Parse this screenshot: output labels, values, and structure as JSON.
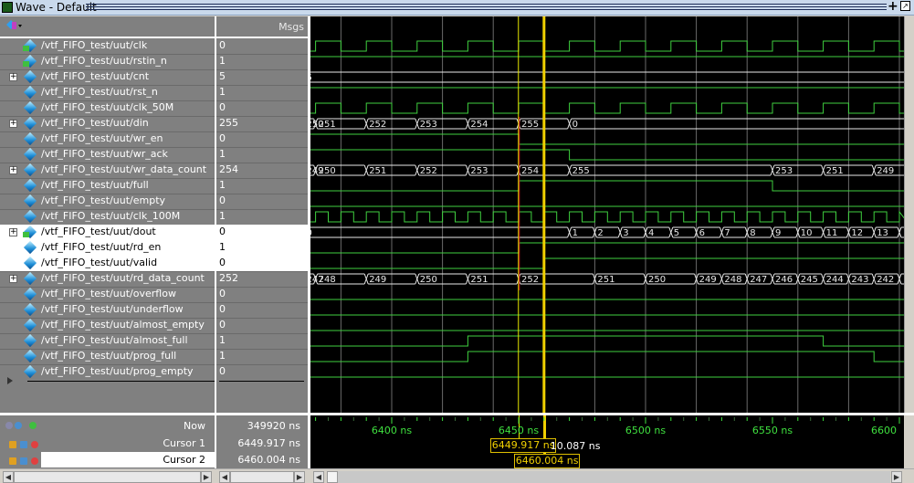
{
  "window": {
    "title": "Wave - Default"
  },
  "header": {
    "msgs_label": "Msgs"
  },
  "colors": {
    "wave_bg": "#000000",
    "signal": "#3fd03f",
    "bus": "#e8e8e8",
    "cursor1": "#e8e800",
    "cursor2": "#f0d000",
    "timeline_text": "#3fe03f"
  },
  "time_axis": {
    "unit": "ns",
    "ticks": [
      6400,
      6450,
      6500,
      6550,
      6600
    ],
    "tick_labels": [
      "6400 ns",
      "6450 ns",
      "6500 ns",
      "6550 ns",
      "6600"
    ],
    "range": [
      6368,
      6602
    ]
  },
  "signals": [
    {
      "name": "/vtf_FIFO_test/uut/clk",
      "value": "0",
      "kind": "clock",
      "period": 20,
      "first_rise": 6370,
      "high": 10,
      "icon": "input"
    },
    {
      "name": "/vtf_FIFO_test/uut/rstin_n",
      "value": "1",
      "kind": "bit",
      "changes": [
        [
          6360,
          1
        ]
      ],
      "icon": "input"
    },
    {
      "name": "/vtf_FIFO_test/uut/cnt",
      "value": "5",
      "kind": "bus",
      "expandable": true,
      "changes": [
        [
          6360,
          "5"
        ]
      ]
    },
    {
      "name": "/vtf_FIFO_test/uut/rst_n",
      "value": "1",
      "kind": "bit",
      "changes": [
        [
          6360,
          1
        ]
      ]
    },
    {
      "name": "/vtf_FIFO_test/uut/clk_50M",
      "value": "0",
      "kind": "clock",
      "period": 20,
      "first_rise": 6370,
      "high": 10
    },
    {
      "name": "/vtf_FIFO_test/uut/din",
      "value": "255",
      "kind": "bus",
      "expandable": true,
      "changes": [
        [
          6360,
          "250"
        ],
        [
          6370,
          "251"
        ],
        [
          6390,
          "252"
        ],
        [
          6410,
          "253"
        ],
        [
          6430,
          "254"
        ],
        [
          6450,
          "255"
        ],
        [
          6470,
          "0"
        ]
      ]
    },
    {
      "name": "/vtf_FIFO_test/uut/wr_en",
      "value": "0",
      "kind": "bit",
      "changes": [
        [
          6360,
          1
        ],
        [
          6450,
          0
        ]
      ]
    },
    {
      "name": "/vtf_FIFO_test/uut/wr_ack",
      "value": "1",
      "kind": "bit",
      "changes": [
        [
          6360,
          1
        ],
        [
          6450,
          1
        ],
        [
          6470,
          0
        ]
      ]
    },
    {
      "name": "/vtf_FIFO_test/uut/wr_data_count",
      "value": "254",
      "kind": "bus",
      "expandable": true,
      "changes": [
        [
          6360,
          "249"
        ],
        [
          6370,
          "250"
        ],
        [
          6390,
          "251"
        ],
        [
          6410,
          "252"
        ],
        [
          6430,
          "253"
        ],
        [
          6450,
          "254"
        ],
        [
          6470,
          "255"
        ],
        [
          6550,
          "253"
        ],
        [
          6570,
          "251"
        ],
        [
          6590,
          "249"
        ]
      ]
    },
    {
      "name": "/vtf_FIFO_test/uut/full",
      "value": "1",
      "kind": "bit",
      "changes": [
        [
          6360,
          0
        ],
        [
          6450,
          1
        ],
        [
          6550,
          0
        ]
      ]
    },
    {
      "name": "/vtf_FIFO_test/uut/empty",
      "value": "0",
      "kind": "bit",
      "changes": [
        [
          6360,
          0
        ]
      ]
    },
    {
      "name": "/vtf_FIFO_test/uut/clk_100M",
      "value": "1",
      "kind": "clock",
      "period": 10,
      "first_rise": 6370,
      "high": 5
    },
    {
      "name": "/vtf_FIFO_test/uut/dout",
      "value": "0",
      "kind": "bus",
      "expandable": true,
      "selected": true,
      "icon": "output",
      "changes": [
        [
          6360,
          "0"
        ],
        [
          6470,
          "1"
        ],
        [
          6480,
          "2"
        ],
        [
          6490,
          "3"
        ],
        [
          6500,
          "4"
        ],
        [
          6510,
          "5"
        ],
        [
          6520,
          "6"
        ],
        [
          6530,
          "7"
        ],
        [
          6540,
          "8"
        ],
        [
          6550,
          "9"
        ],
        [
          6560,
          "10"
        ],
        [
          6570,
          "11"
        ],
        [
          6580,
          "12"
        ],
        [
          6590,
          "13"
        ],
        [
          6600,
          ""
        ]
      ]
    },
    {
      "name": "/vtf_FIFO_test/uut/rd_en",
      "value": "1",
      "kind": "bit",
      "selected": true,
      "changes": [
        [
          6360,
          0
        ],
        [
          6450,
          1
        ]
      ]
    },
    {
      "name": "/vtf_FIFO_test/uut/valid",
      "value": "0",
      "kind": "bit",
      "selected": true,
      "changes": [
        [
          6360,
          0
        ],
        [
          6460,
          1
        ]
      ]
    },
    {
      "name": "/vtf_FIFO_test/uut/rd_data_count",
      "value": "252",
      "kind": "bus",
      "expandable": true,
      "changes": [
        [
          6360,
          "247"
        ],
        [
          6370,
          "248"
        ],
        [
          6390,
          "249"
        ],
        [
          6410,
          "250"
        ],
        [
          6430,
          "251"
        ],
        [
          6450,
          "252"
        ],
        [
          6480,
          "251"
        ],
        [
          6500,
          "250"
        ],
        [
          6520,
          "249"
        ],
        [
          6530,
          "248"
        ],
        [
          6540,
          "247"
        ],
        [
          6550,
          "246"
        ],
        [
          6560,
          "245"
        ],
        [
          6570,
          "244"
        ],
        [
          6580,
          "243"
        ],
        [
          6590,
          "242"
        ],
        [
          6600,
          ""
        ]
      ]
    },
    {
      "name": "/vtf_FIFO_test/uut/overflow",
      "value": "0",
      "kind": "bit",
      "changes": [
        [
          6360,
          0
        ]
      ]
    },
    {
      "name": "/vtf_FIFO_test/uut/underflow",
      "value": "0",
      "kind": "bit",
      "changes": [
        [
          6360,
          0
        ]
      ]
    },
    {
      "name": "/vtf_FIFO_test/uut/almost_empty",
      "value": "0",
      "kind": "bit",
      "changes": [
        [
          6360,
          0
        ]
      ]
    },
    {
      "name": "/vtf_FIFO_test/uut/almost_full",
      "value": "1",
      "kind": "bit",
      "changes": [
        [
          6360,
          0
        ],
        [
          6430,
          1
        ],
        [
          6570,
          0
        ]
      ]
    },
    {
      "name": "/vtf_FIFO_test/uut/prog_full",
      "value": "1",
      "kind": "bit",
      "changes": [
        [
          6360,
          0
        ],
        [
          6430,
          1
        ],
        [
          6590,
          0
        ]
      ]
    },
    {
      "name": "/vtf_FIFO_test/uut/prog_empty",
      "value": "0",
      "kind": "bit",
      "changes": [
        [
          6360,
          0
        ]
      ]
    }
  ],
  "footer": {
    "now_label": "Now",
    "now_value": "349920 ns",
    "cursor1_label": "Cursor 1",
    "cursor1_value": "6449.917 ns",
    "cursor1_time": 6449.917,
    "cursor2_label": "Cursor 2",
    "cursor2_value": "6460.004 ns",
    "cursor2_time": 6460.004,
    "cursor1_box": "6449.917 ns",
    "cursor2_box": "6460.004 ns",
    "delta": "10.087 ns"
  }
}
